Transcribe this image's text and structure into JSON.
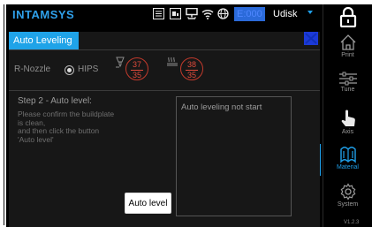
{
  "header": {
    "brand": "INTAMSYS",
    "error_code": "E:000",
    "storage": "Udisk"
  },
  "nav": {
    "print": "Print",
    "tune": "Tune",
    "axis": "Axis",
    "material": "Material",
    "system": "System",
    "active": "Material",
    "version": "V1.2.3"
  },
  "dialog": {
    "title": "Auto Leveling",
    "nozzle_label": "R-Nozzle",
    "material": "HIPS",
    "nozzle_temp": {
      "current": "37",
      "target": "35"
    },
    "bed_temp": {
      "current": "38",
      "target": "35"
    },
    "step_title": "Step 2 - Auto level:",
    "instructions": [
      "Please confirm the buildplate",
      "is clean,",
      "and then click the button",
      "'Auto level'"
    ],
    "button_label": "Auto level",
    "status_text": "Auto leveling not start"
  },
  "colors": {
    "accent": "#1fa3e8",
    "temp_ring": "#c23a2c",
    "close_button": "#1c3ad8",
    "error_badge": "#2b6ad9"
  }
}
